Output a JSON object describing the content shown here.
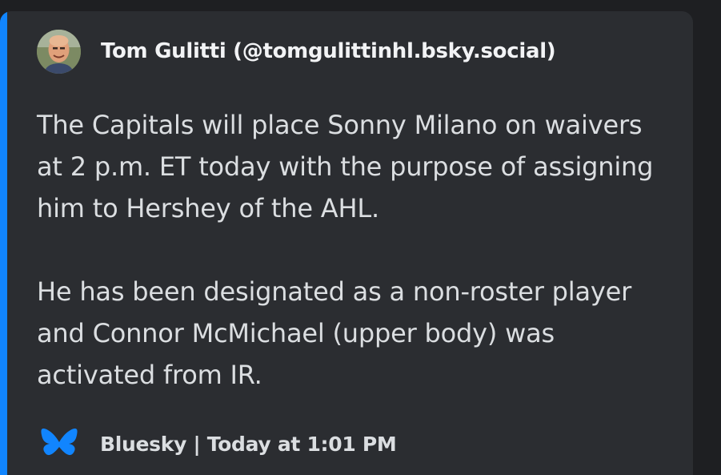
{
  "embed": {
    "accent_color": "#1185fe",
    "author": {
      "display": "Tom Gulitti (@tomgulittinhl.bsky.social)",
      "avatar_icon": "person-avatar-icon"
    },
    "text": "The Capitals will place Sonny Milano on waivers at 2 p.m. ET today with the purpose of assigning him to Hershey of the AHL.\n\nHe has been designated as a non-roster player and Connor McMichael (upper body) was activated from IR.",
    "footer": {
      "icon": "bluesky-butterfly-icon",
      "text": "Bluesky | Today at 1:01 PM"
    }
  }
}
